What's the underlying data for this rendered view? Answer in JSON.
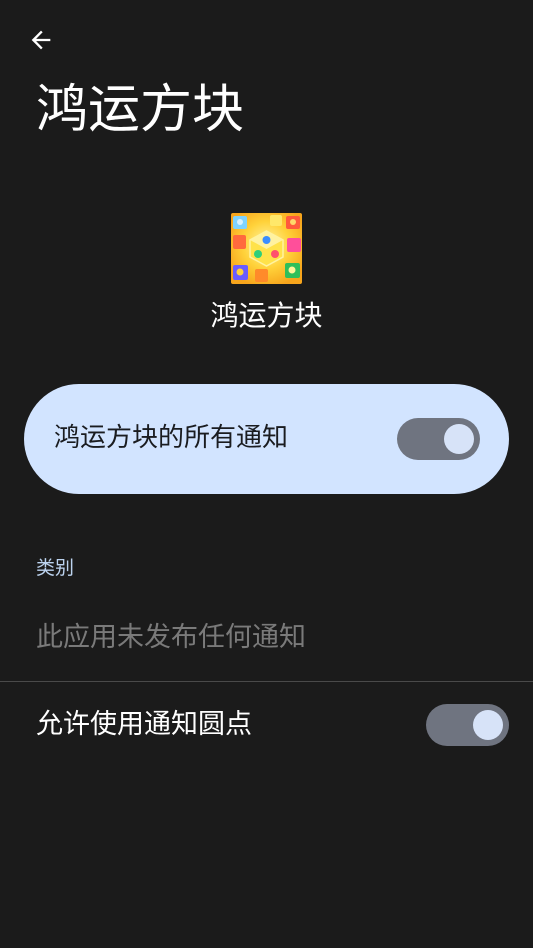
{
  "header": {
    "back_icon": "arrow-back-icon",
    "title": "鸿运方块"
  },
  "app": {
    "icon": "app-icon",
    "name": "鸿运方块"
  },
  "master_setting": {
    "label": "鸿运方块的所有通知",
    "enabled": true
  },
  "categories": {
    "header": "类别",
    "empty_text": "此应用未发布任何通知"
  },
  "notification_dots": {
    "label": "允许使用通知圆点",
    "enabled": true
  },
  "colors": {
    "background": "#1b1b1b",
    "card": "#d2e4ff",
    "toggle_track": "#6f7480",
    "toggle_knob": "#d7e3f8",
    "section_header": "#bcd3ef",
    "muted_text": "#7a7a7a"
  }
}
